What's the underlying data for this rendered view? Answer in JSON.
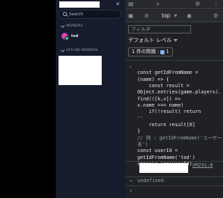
{
  "sidebar": {
    "search_placeholder": "Search",
    "close_icon": "✕",
    "members_header": "MEMBERS",
    "member_name": "tod",
    "offline_header": "OFFLINE MEMBERS"
  },
  "devtools": {
    "top_label": "top",
    "filter_placeholder": "フィルタ",
    "level_label": "デフォルト レベル",
    "issues_label": "1 件の問題 :",
    "issues_count": "1",
    "source_link": "VM291:8",
    "undefined_text": "undefined"
  },
  "code_lines": [
    "const getIdFromName =",
    "(name) => {",
    "    const result =",
    "Object.entries(game.players).find(([k,v]) =>",
    "v.name === name)",
    "    if(!result) return",
    "''",
    "    return result[0]",
    "}",
    "// 例 : getIdFromName('ユーザー名')",
    "const userId =",
    "getIdFromName('tod')",
    "console.log(userId)"
  ],
  "colors": {
    "sidebar_bg": "#161c2b",
    "devtools_bg": "#202124",
    "accent": "#8ab4f8"
  }
}
